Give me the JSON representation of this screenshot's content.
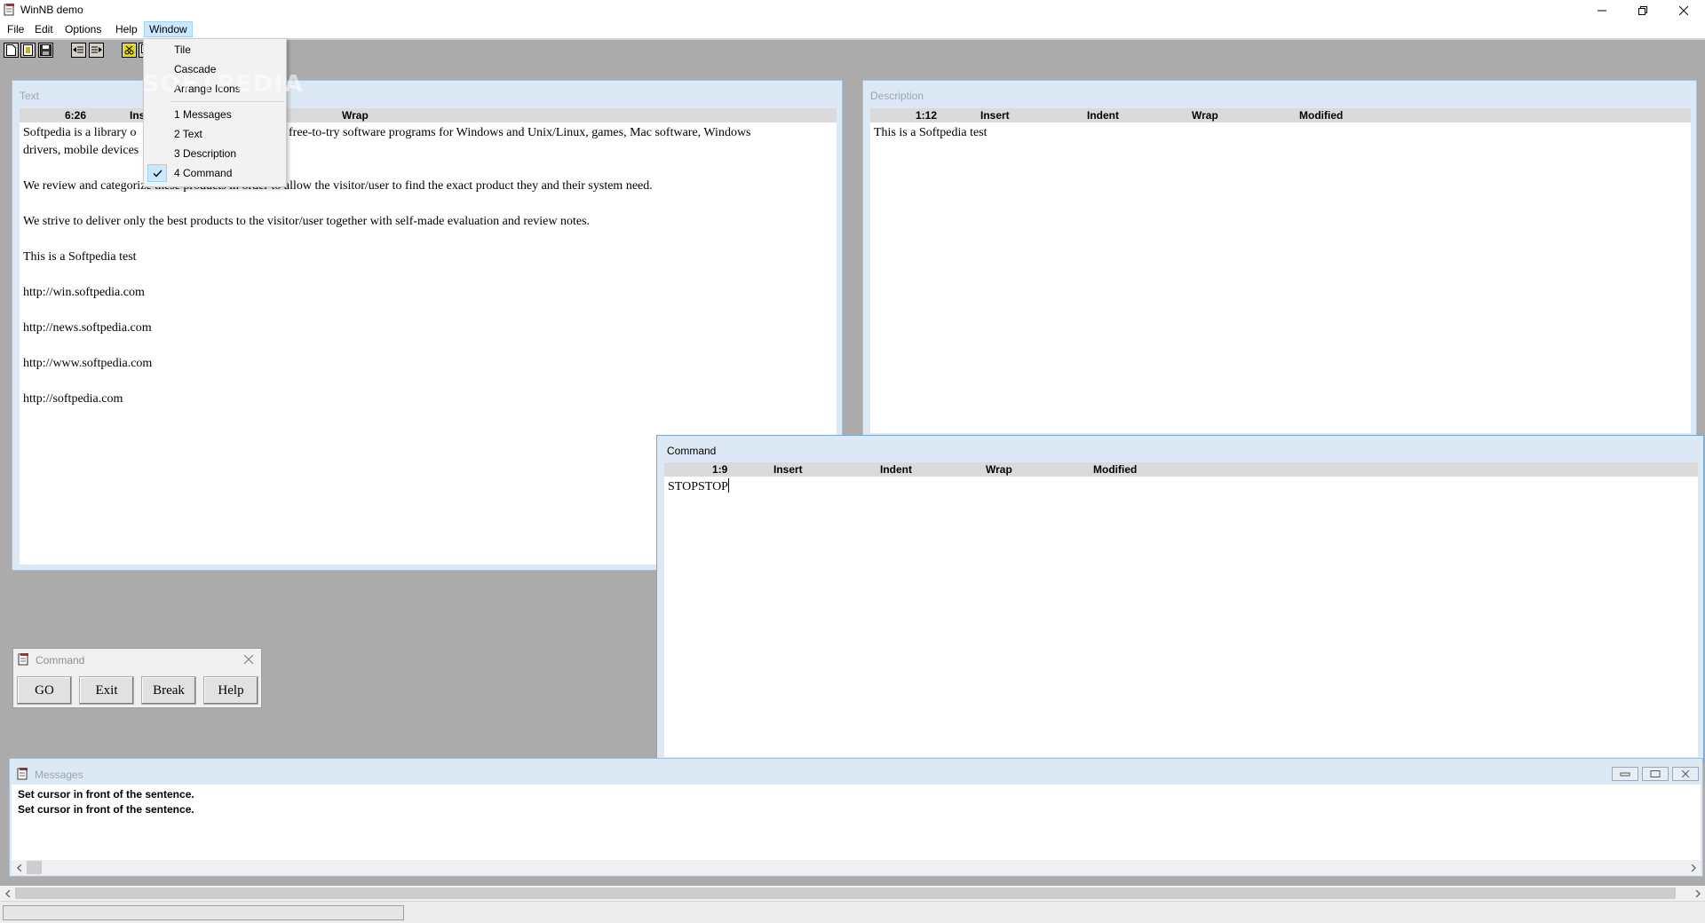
{
  "app": {
    "title": "WinNB demo"
  },
  "menubar": {
    "items": [
      "File",
      "Edit",
      "Options",
      "Help",
      "Window"
    ]
  },
  "window_menu": {
    "items": [
      "Tile",
      "Cascade",
      "Arrange Icons"
    ],
    "windows": [
      "1 Messages",
      "2 Text",
      "3 Description",
      "4 Command"
    ],
    "checked": "4 Command"
  },
  "watermark": "SOFTPEDIA",
  "text_window": {
    "title": "Text",
    "status": {
      "position": "6:26",
      "insert": "Ins",
      "wrap": "Wrap"
    },
    "paragraphs": [
      "Softpedia is a library o",
      "free-to-try software programs for Windows and Unix/Linux, games, Mac software, Windows",
      "drivers, mobile devices",
      "We review and categorize these products in order to allow the visitor/user to find the exact product they and their system need.",
      "We strive to deliver only the best products to the visitor/user together with self-made evaluation and review notes.",
      "This is a Softpedia test",
      "http://win.softpedia.com",
      "http://news.softpedia.com",
      "http://www.softpedia.com",
      "http://softpedia.com"
    ]
  },
  "description_window": {
    "title": "Description",
    "status": {
      "position": "1:12",
      "insert": "Insert",
      "indent": "Indent",
      "wrap": "Wrap",
      "modified": "Modified"
    },
    "content": "This is a Softpedia test"
  },
  "command_window": {
    "title": "Command",
    "status": {
      "position": "1:9",
      "insert": "Insert",
      "indent": "Indent",
      "wrap": "Wrap",
      "modified": "Modified"
    },
    "content": "STOPSTOP"
  },
  "command_dialog": {
    "title": "Command",
    "buttons": [
      "GO",
      "Exit",
      "Break",
      "Help"
    ]
  },
  "messages_window": {
    "title": "Messages",
    "lines": [
      "Set cursor in front of the sentence.",
      "Set cursor in front of the sentence."
    ]
  },
  "statusbar": {
    "progress": 0.235
  },
  "colors": {
    "menu_highlight": "#cce8ff",
    "mdi_frame": "#dce8f4",
    "mdi_background": "#ababab",
    "progress": "#3c8dde"
  }
}
